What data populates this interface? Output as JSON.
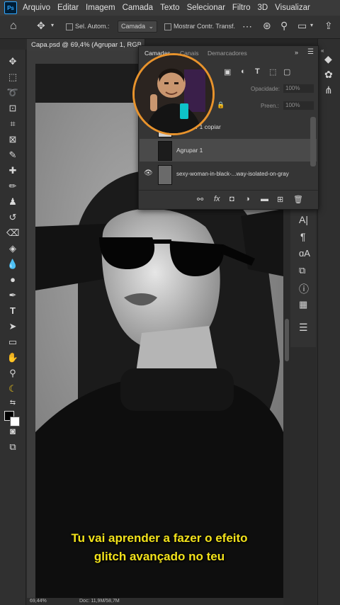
{
  "menubar": {
    "app_badge": "Ps",
    "items": [
      "Arquivo",
      "Editar",
      "Imagem",
      "Camada",
      "Texto",
      "Selecionar",
      "Filtro",
      "3D",
      "Visualizar"
    ]
  },
  "options": {
    "auto_select_label": "Sel. Autom.:",
    "auto_select_target": "Camada",
    "transform_controls_label": "Mostrar Contr. Transf."
  },
  "document": {
    "tab_title": "Capa.psd @ 69,4% (Agrupar 1, RGB",
    "zoom": "69,44%",
    "doc_info": "Doc: 11,9M/58,7M"
  },
  "layers_panel": {
    "tabs": [
      "Camadas",
      "Canais",
      "Demarcadores"
    ],
    "opacity_label": "Opacidade:",
    "opacity_value": "100%",
    "fill_label": "Preen.:",
    "fill_value": "100%",
    "layers": [
      {
        "name": "Agrupar 1 copiar"
      },
      {
        "name": "Agrupar 1"
      },
      {
        "name": "sexy-woman-in-black-...way-isolated-on-gray"
      }
    ]
  },
  "caption": {
    "line1": "Tu vai aprender a fazer o efeito",
    "line2": "glitch avançado no teu"
  },
  "colors": {
    "caption": "#f2e21b",
    "avatar_ring": "#e8932c",
    "accent": "#31a8ff"
  }
}
